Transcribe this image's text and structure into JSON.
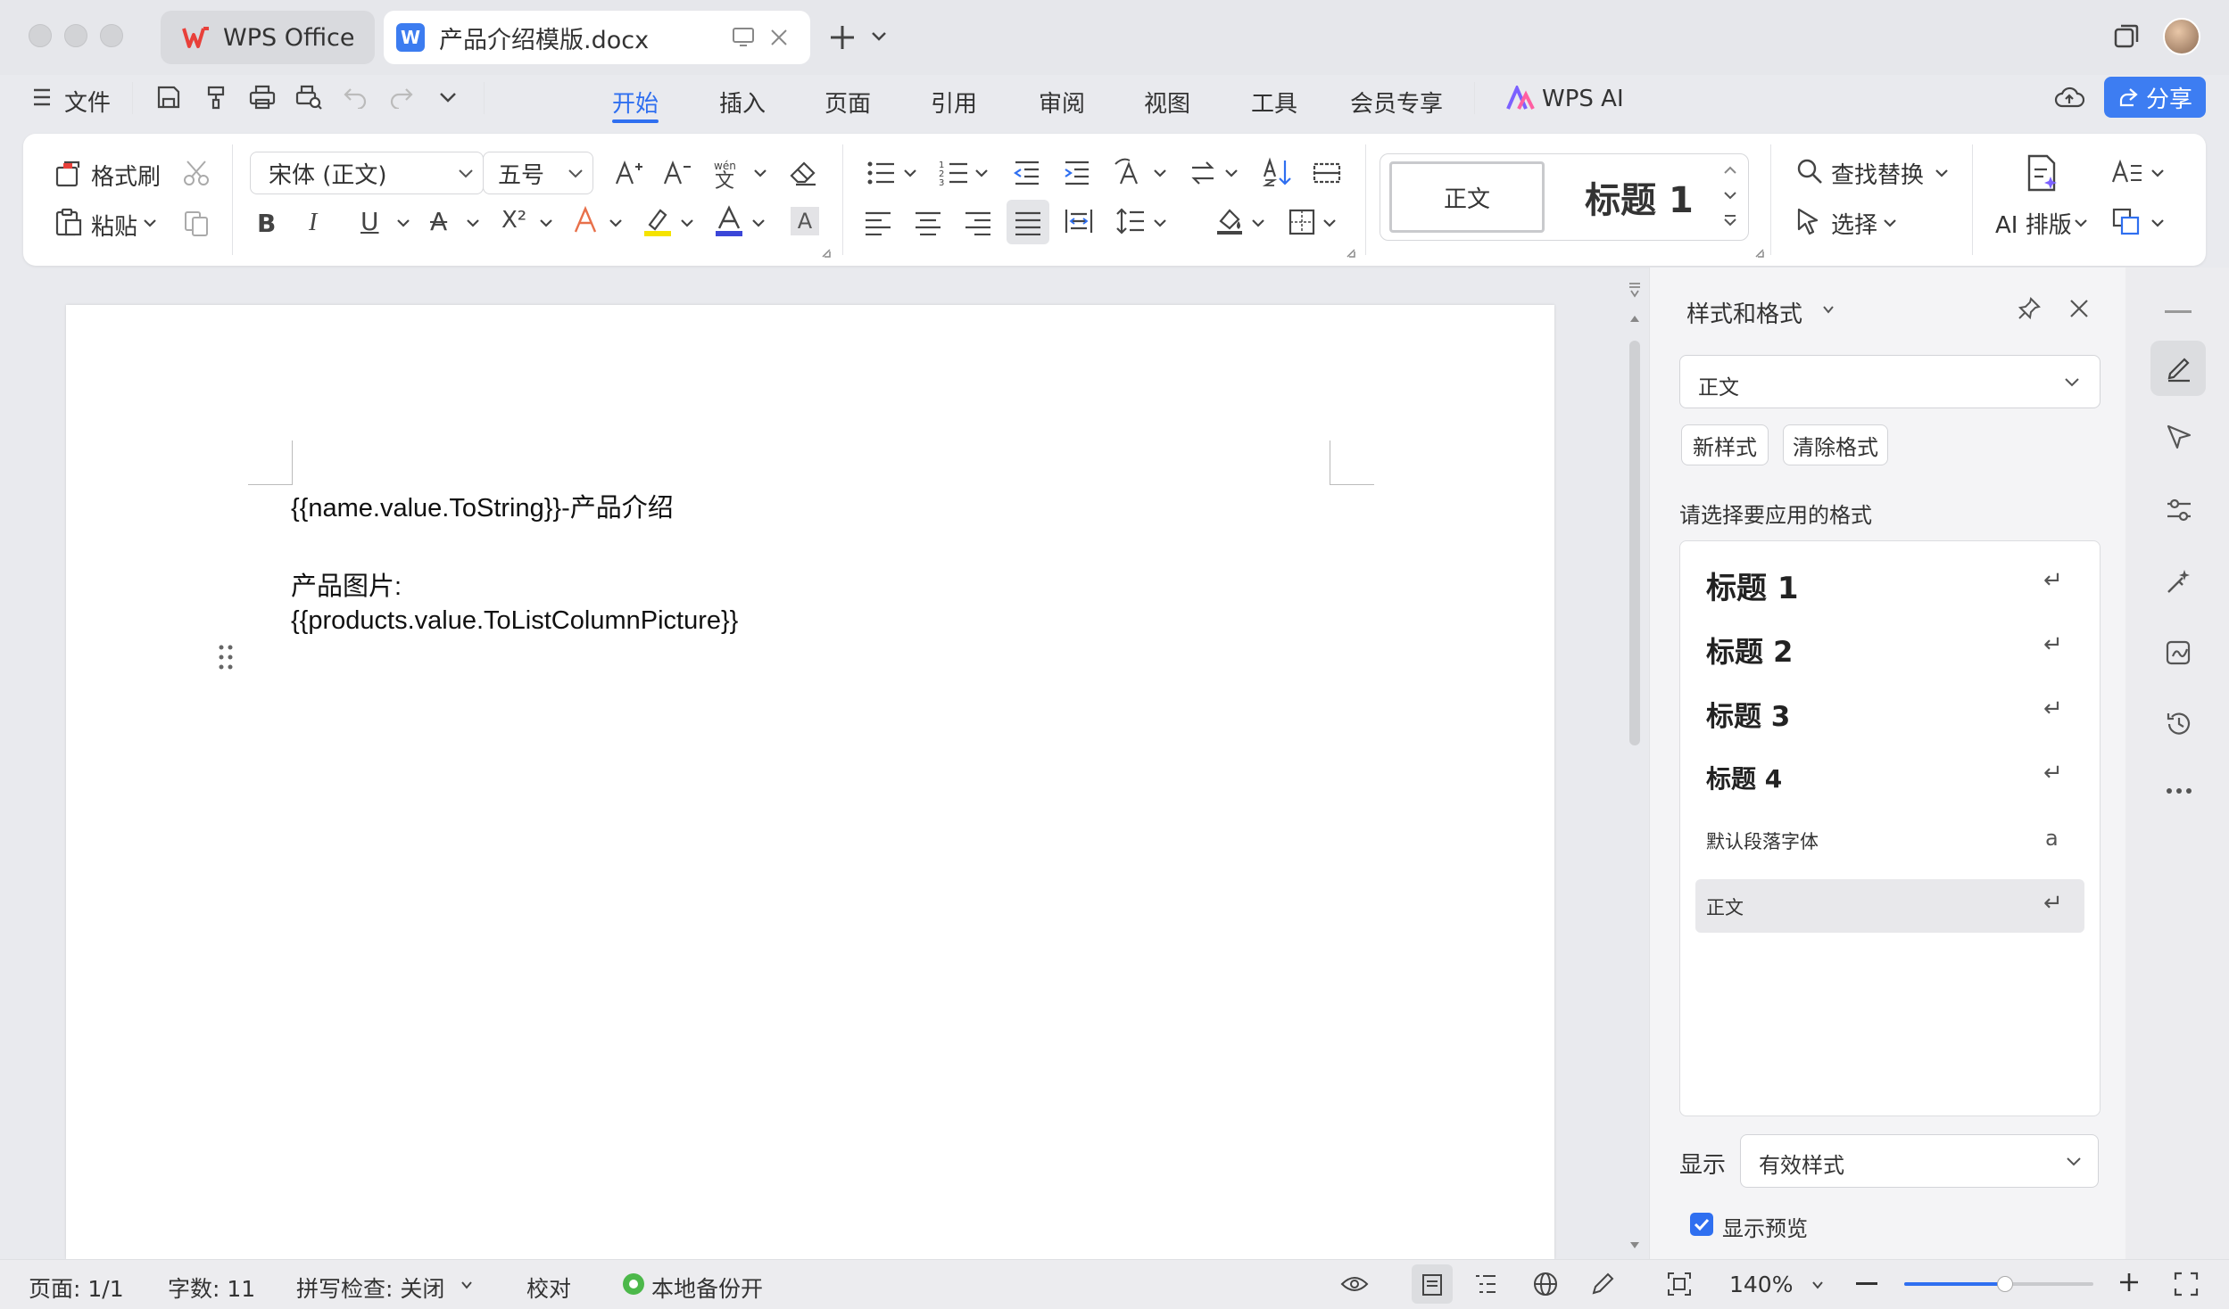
{
  "window": {
    "tabs": [
      {
        "label": "WPS Office"
      },
      {
        "label": "产品介绍模版.docx"
      }
    ]
  },
  "menubar": {
    "file_label": "文件",
    "tabs": [
      "开始",
      "插入",
      "页面",
      "引用",
      "审阅",
      "视图",
      "工具",
      "会员专享",
      "WPS AI"
    ],
    "active_tab": "开始",
    "share_label": "分享"
  },
  "ribbon": {
    "format_painter": "格式刷",
    "paste": "粘贴",
    "font_name": "宋体 (正文)",
    "font_size": "五号",
    "style_normal": "正文",
    "style_heading": "标题 1",
    "find_replace": "查找替换",
    "select": "选择",
    "ai_layout": "AI 排版"
  },
  "document": {
    "line1": "{{name.value.ToString}}-产品介绍",
    "line2": "产品图片:",
    "line3": "{{products.value.ToListColumnPicture}}"
  },
  "styles_pane": {
    "title": "样式和格式",
    "current_style": "正文",
    "new_style": "新样式",
    "clear_format": "清除格式",
    "prompt": "请选择要应用的格式",
    "items": [
      {
        "label": "标题 1"
      },
      {
        "label": "标题 2"
      },
      {
        "label": "标题 3"
      },
      {
        "label": "标题 4"
      },
      {
        "label": "默认段落字体"
      },
      {
        "label": "正文"
      }
    ],
    "selected_item": "正文",
    "show_label": "显示",
    "show_value": "有效样式",
    "preview_label": "显示预览",
    "preview_checked": true
  },
  "statusbar": {
    "page": "页面: 1/1",
    "words": "字数: 11",
    "spellcheck": "拼写检查: 关闭",
    "proofread": "校对",
    "backup": "本地备份开",
    "zoom": "140%"
  },
  "colors": {
    "accent": "#2f6ff0",
    "share_button": "#3d7df2",
    "highlight_yellow": "#f5e300",
    "font_color_blue": "#3b46d8",
    "backup_green": "#4cb84a"
  }
}
